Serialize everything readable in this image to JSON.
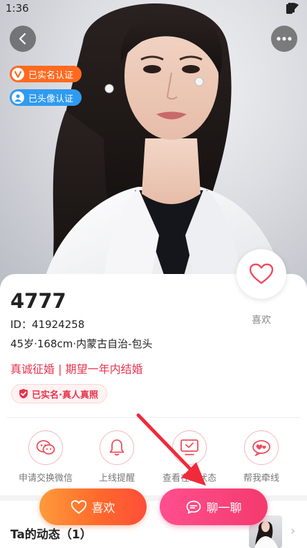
{
  "status_bar": {
    "time": "1:36"
  },
  "header": {
    "back_icon": "chevron-left-icon",
    "more_icon": "more-dots-icon"
  },
  "badges": {
    "real_name": "已实名认证",
    "avatar_verified": "已头像认证"
  },
  "profile": {
    "name": "4777",
    "id_label": "ID：",
    "id_value": "41924258",
    "info": "45岁·168cm·内蒙古自治-包头",
    "intent": "真诚征婚 | 期望一年内结婚",
    "verify_chip": "已实名·真人真照"
  },
  "like_side": {
    "label": "喜欢"
  },
  "actions": [
    {
      "label": "申请交换微信",
      "icon": "wechat-icon"
    },
    {
      "label": "上线提醒",
      "icon": "bell-icon"
    },
    {
      "label": "查看在线状态",
      "icon": "monitor-check-icon"
    },
    {
      "label": "帮我牵线",
      "icon": "hearts-icon"
    }
  ],
  "moments": {
    "title": "Ta的动态（1）"
  },
  "bottom_buttons": {
    "like": "喜欢",
    "chat": "聊一聊"
  },
  "colors": {
    "accent_red": "#e8344f",
    "orange": "#ff6a1f",
    "blue": "#2f9bf0",
    "chat_pink": "#f43a6e"
  }
}
